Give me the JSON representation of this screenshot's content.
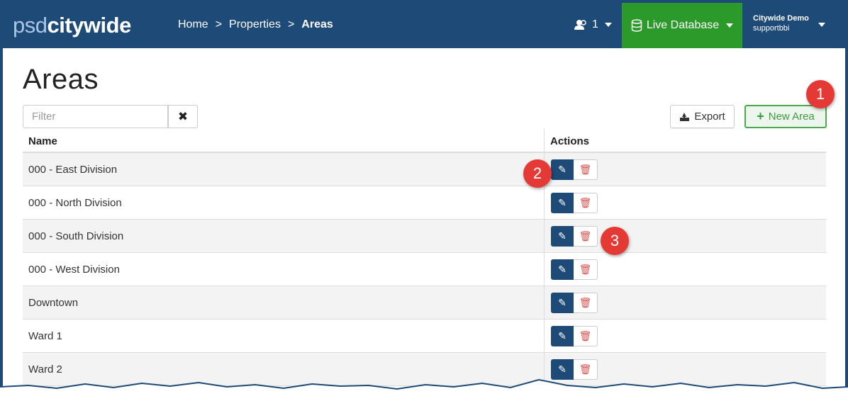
{
  "brand": {
    "part1": "psd",
    "part2": "citywide"
  },
  "breadcrumb": [
    {
      "label": "Home"
    },
    {
      "label": "Properties"
    },
    {
      "label": "Areas"
    }
  ],
  "breadcrumb_sep": ">",
  "users": {
    "count": "1"
  },
  "database": {
    "label": "Live Database"
  },
  "account": {
    "org": "Citywide Demo",
    "user": "supportbbi"
  },
  "page": {
    "title": "Areas"
  },
  "filter": {
    "placeholder": "Filter",
    "value": ""
  },
  "toolbar": {
    "export_label": "Export",
    "new_label": "New Area"
  },
  "table": {
    "headers": {
      "name": "Name",
      "actions": "Actions"
    },
    "rows": [
      {
        "name": "000 - East Division"
      },
      {
        "name": "000 - North Division"
      },
      {
        "name": "000 - South Division"
      },
      {
        "name": "000 - West Division"
      },
      {
        "name": "Downtown"
      },
      {
        "name": "Ward 1"
      },
      {
        "name": "Ward 2"
      }
    ]
  },
  "callouts": {
    "c1": "1",
    "c2": "2",
    "c3": "3"
  },
  "colors": {
    "navbar": "#1e4a78",
    "live_db": "#2b9a2b",
    "new_button": "#3d9a3d",
    "callout": "#e53935",
    "delete": "#d9534f"
  },
  "icons": {
    "users": "user-group-icon",
    "database": "database-icon",
    "export": "export-icon",
    "plus": "plus-icon",
    "clear": "close-icon",
    "edit": "pencil-icon",
    "delete": "trash-icon"
  }
}
